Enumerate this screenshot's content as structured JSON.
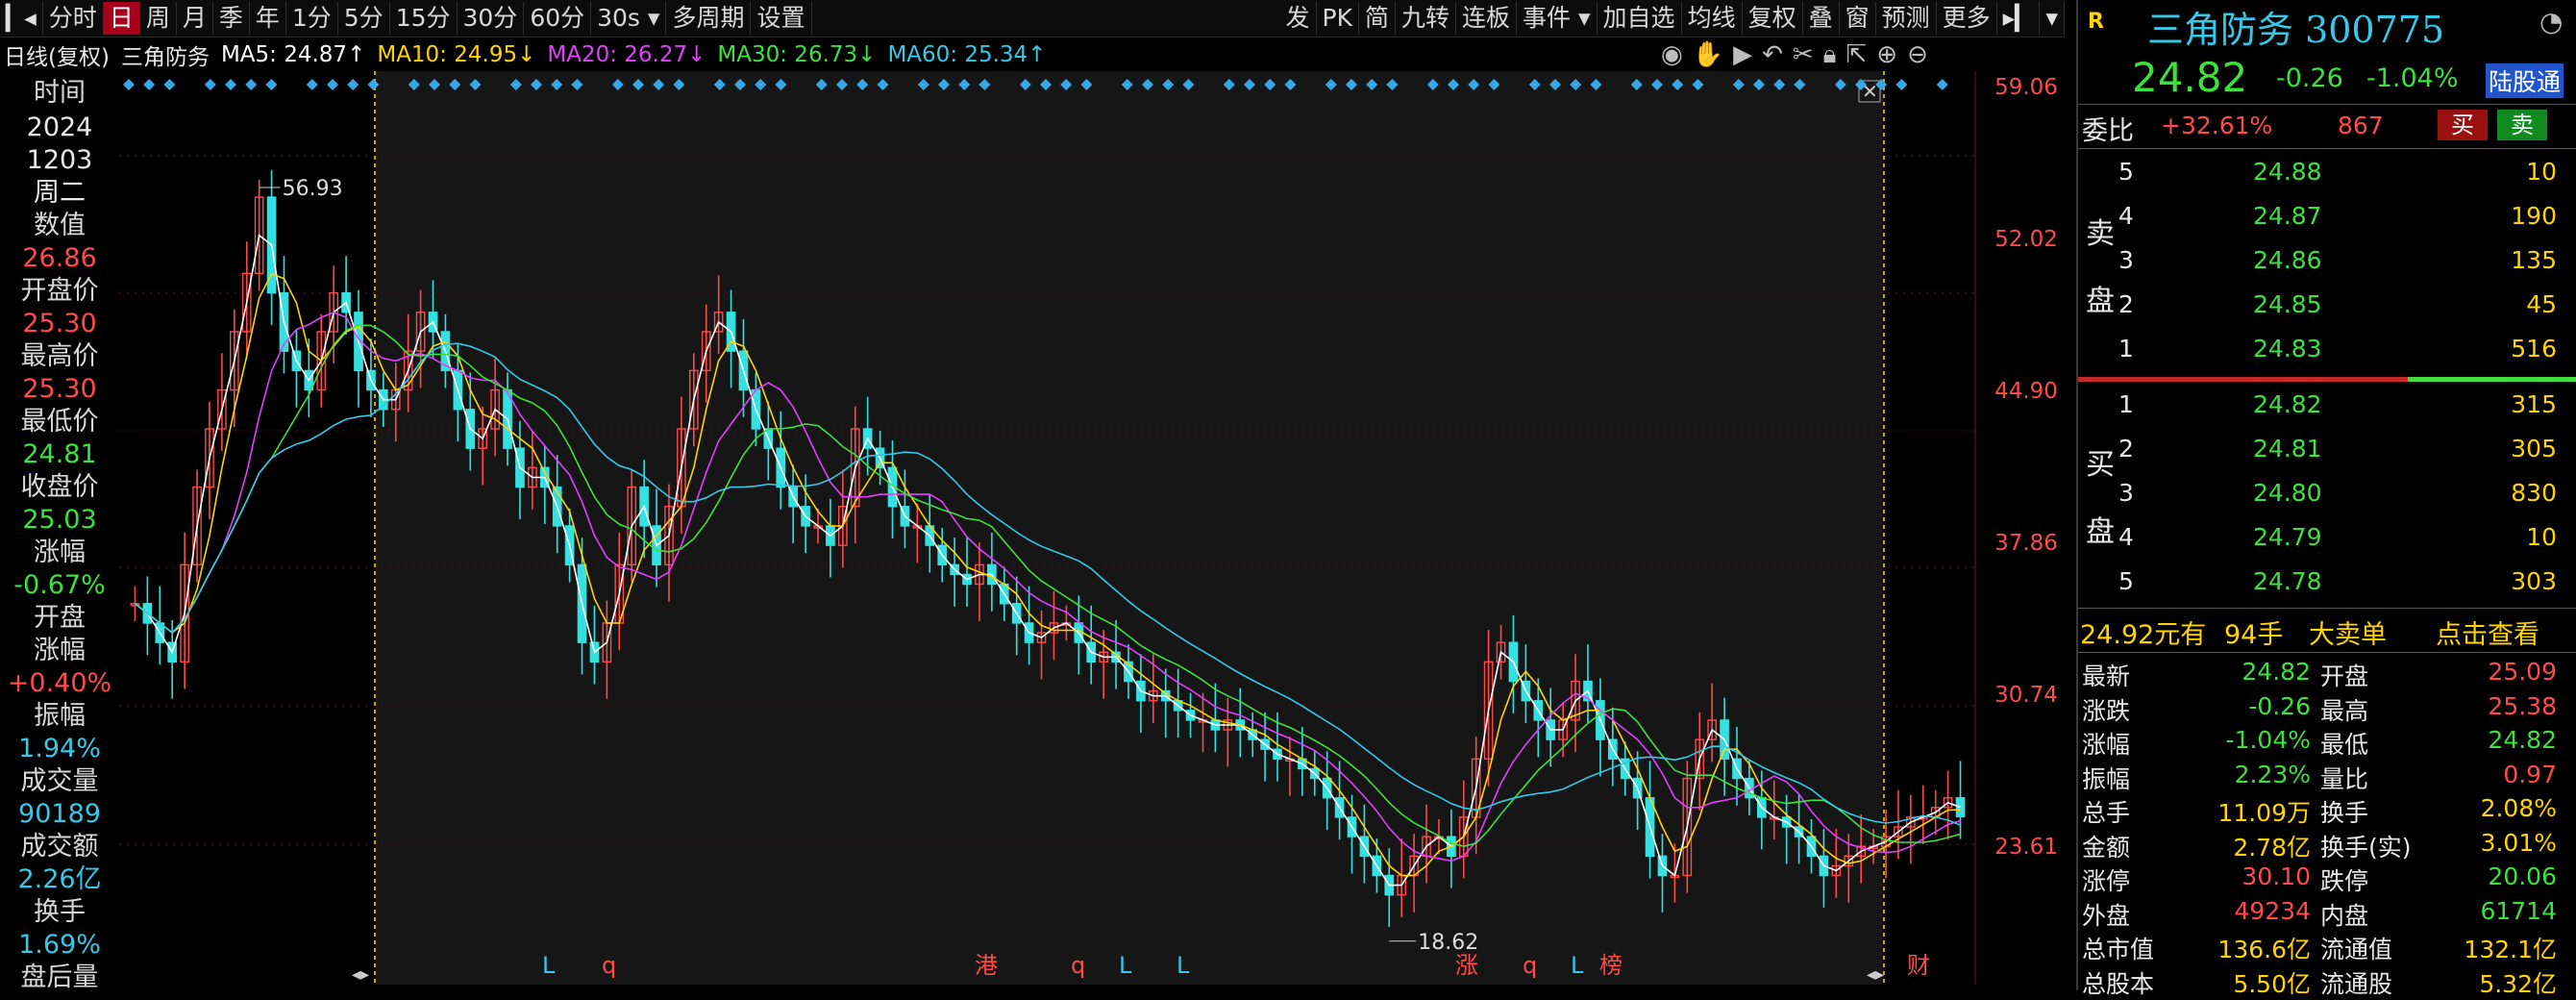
{
  "toolbar": {
    "left": [
      "分时",
      "日",
      "周",
      "月",
      "季",
      "年",
      "1分",
      "5分",
      "15分",
      "30分",
      "60分",
      "30s ▾",
      "多周期",
      "设置"
    ],
    "active_index": 1,
    "right": [
      "发",
      "PK",
      "简",
      "九转",
      "连板",
      "事件 ▾",
      "加自选",
      "均线",
      "复权",
      "叠",
      "窗",
      "预测",
      "更多"
    ]
  },
  "mabar": {
    "period": "日线(复权)",
    "name": "三角防务",
    "ma5": "MA5: 24.87↑",
    "ma10": "MA10: 24.95↓",
    "ma20": "MA20: 26.27↓",
    "ma30": "MA30: 26.73↓",
    "ma60": "MA60: 25.34↑"
  },
  "left_info": [
    {
      "t": "时间",
      "c": "lbl"
    },
    {
      "t": "2024",
      "c": "white"
    },
    {
      "t": "1203",
      "c": "white"
    },
    {
      "t": "周二",
      "c": "white"
    },
    {
      "t": "数值",
      "c": "lbl"
    },
    {
      "t": "26.86",
      "c": "red"
    },
    {
      "t": "开盘价",
      "c": "lbl"
    },
    {
      "t": "25.30",
      "c": "red"
    },
    {
      "t": "最高价",
      "c": "lbl"
    },
    {
      "t": "25.30",
      "c": "red"
    },
    {
      "t": "最低价",
      "c": "lbl"
    },
    {
      "t": "24.81",
      "c": "grn"
    },
    {
      "t": "收盘价",
      "c": "lbl"
    },
    {
      "t": "25.03",
      "c": "grn"
    },
    {
      "t": "涨幅",
      "c": "lbl"
    },
    {
      "t": "-0.67%",
      "c": "grn"
    },
    {
      "t": "开盘",
      "c": "lbl"
    },
    {
      "t": "涨幅",
      "c": "lbl"
    },
    {
      "t": "+0.40%",
      "c": "red"
    },
    {
      "t": "振幅",
      "c": "lbl"
    },
    {
      "t": "1.94%",
      "c": "cyan"
    },
    {
      "t": "成交量",
      "c": "lbl"
    },
    {
      "t": "90189",
      "c": "cyan"
    },
    {
      "t": "成交额",
      "c": "lbl"
    },
    {
      "t": "2.26亿",
      "c": "cyan"
    },
    {
      "t": "换手",
      "c": "lbl"
    },
    {
      "t": "1.69%",
      "c": "cyan"
    },
    {
      "t": "盘后量",
      "c": "lbl"
    }
  ],
  "price_axis": [
    "59.06",
    "52.02",
    "44.90",
    "37.86",
    "30.74",
    "23.61"
  ],
  "chart_data": {
    "type": "line",
    "y_range": [
      18.0,
      59.06
    ],
    "close_series": [
      36,
      35,
      34,
      33,
      38,
      42,
      45,
      47,
      50,
      53,
      56.93,
      52,
      49,
      48,
      47,
      50,
      52,
      51,
      48,
      47,
      46,
      47,
      49,
      51,
      50,
      48,
      46,
      44,
      45,
      47,
      44,
      42,
      43,
      42,
      40,
      38,
      34,
      33,
      35,
      38,
      42,
      40,
      38,
      41,
      45,
      48,
      50,
      51,
      49,
      47,
      45,
      44,
      42,
      41,
      40,
      40,
      39,
      41,
      45,
      44,
      43,
      41,
      40,
      40,
      39,
      38,
      37.5,
      37,
      38,
      37,
      36,
      35,
      34,
      34.5,
      35,
      35,
      34,
      33,
      33.5,
      33,
      32,
      31,
      31.5,
      31,
      30.5,
      30,
      30,
      29.5,
      30,
      29.5,
      29,
      28.5,
      28,
      28,
      27.5,
      27,
      26,
      25,
      24,
      23,
      22,
      21,
      22,
      23,
      24,
      24,
      23,
      25,
      28,
      33,
      34,
      32,
      31,
      30,
      29,
      30,
      32,
      31,
      29,
      28,
      27,
      26,
      23,
      22,
      22,
      27,
      29,
      30,
      28,
      27,
      26,
      25,
      25,
      24.5,
      24,
      23,
      22,
      22.5,
      23,
      23.5,
      23.5,
      24,
      24.5,
      25,
      25,
      25.5,
      26,
      25.03
    ],
    "ma_colors": [
      "#ffffff",
      "#ffd400",
      "#e040fb",
      "#3ee03e",
      "#35c8e8"
    ],
    "max_label": "56.93",
    "min_label": "18.62",
    "event_markers": [
      {
        "t": "L",
        "c": "#35c8e8"
      },
      {
        "t": "q",
        "c": "#ff4a4a"
      },
      {
        "t": "港",
        "c": "#ff4a4a"
      },
      {
        "t": "q",
        "c": "#ff4a4a"
      },
      {
        "t": "L",
        "c": "#35c8e8"
      },
      {
        "t": "L",
        "c": "#35c8e8"
      },
      {
        "t": "涨",
        "c": "#ff4a4a"
      },
      {
        "t": "q",
        "c": "#ff4a4a"
      },
      {
        "t": "L",
        "c": "#35c8e8"
      },
      {
        "t": "榜",
        "c": "#ff4a4a"
      },
      {
        "t": "财",
        "c": "#ff4a4a"
      }
    ]
  },
  "quote": {
    "badge": "R",
    "title": "三角防务 300775",
    "price": "24.82",
    "change": "-0.26",
    "pct": "-1.04%",
    "tag": "陆股通",
    "weibi_label": "委比",
    "weibi": "+32.61%",
    "weicha": "867",
    "buy_btn": "买",
    "sell_btn": "卖"
  },
  "sell_side_label": [
    "卖",
    "盘"
  ],
  "buy_side_label": [
    "买",
    "盘"
  ],
  "asks": [
    {
      "n": "5",
      "p": "24.88",
      "v": "10"
    },
    {
      "n": "4",
      "p": "24.87",
      "v": "190"
    },
    {
      "n": "3",
      "p": "24.86",
      "v": "135"
    },
    {
      "n": "2",
      "p": "24.85",
      "v": "45"
    },
    {
      "n": "1",
      "p": "24.83",
      "v": "516"
    }
  ],
  "bids": [
    {
      "n": "1",
      "p": "24.82",
      "v": "315"
    },
    {
      "n": "2",
      "p": "24.81",
      "v": "305"
    },
    {
      "n": "3",
      "p": "24.80",
      "v": "830"
    },
    {
      "n": "4",
      "p": "24.79",
      "v": "10"
    },
    {
      "n": "5",
      "p": "24.78",
      "v": "303"
    }
  ],
  "big_order": {
    "price": "24.92元有",
    "lots": "94手",
    "label": "大卖单",
    "link": "点击查看"
  },
  "stats": [
    {
      "l1": "最新",
      "v1": "24.82",
      "c1": "grn",
      "l2": "开盘",
      "v2": "25.09",
      "c2": "red"
    },
    {
      "l1": "涨跌",
      "v1": "-0.26",
      "c1": "grn",
      "l2": "最高",
      "v2": "25.38",
      "c2": "red"
    },
    {
      "l1": "涨幅",
      "v1": "-1.04%",
      "c1": "grn",
      "l2": "最低",
      "v2": "24.82",
      "c2": "grn"
    },
    {
      "l1": "振幅",
      "v1": "2.23%",
      "c1": "grn",
      "l2": "量比",
      "v2": "0.97",
      "c2": "red"
    },
    {
      "l1": "总手",
      "v1": "11.09万",
      "c1": "yel",
      "l2": "换手",
      "v2": "2.08%",
      "c2": "yel"
    },
    {
      "l1": "金额",
      "v1": "2.78亿",
      "c1": "yel",
      "l2": "换手(实)",
      "v2": "3.01%",
      "c2": "yel"
    },
    {
      "l1": "涨停",
      "v1": "30.10",
      "c1": "red",
      "l2": "跌停",
      "v2": "20.06",
      "c2": "grn"
    },
    {
      "l1": "外盘",
      "v1": "49234",
      "c1": "red",
      "l2": "内盘",
      "v2": "61714",
      "c2": "grn"
    },
    {
      "l1": "总市值",
      "v1": "136.6亿",
      "c1": "yel",
      "l2": "流通值",
      "v2": "132.1亿",
      "c2": "yel"
    },
    {
      "l1": "总股本",
      "v1": "5.50亿",
      "c1": "yel",
      "l2": "流通股",
      "v2": "5.32亿",
      "c2": "yel"
    }
  ],
  "colors": {
    "up": "#ff4a4a",
    "down": "#3ee03e",
    "accent": "#35c8e8",
    "active_tab": "#a8001c"
  }
}
